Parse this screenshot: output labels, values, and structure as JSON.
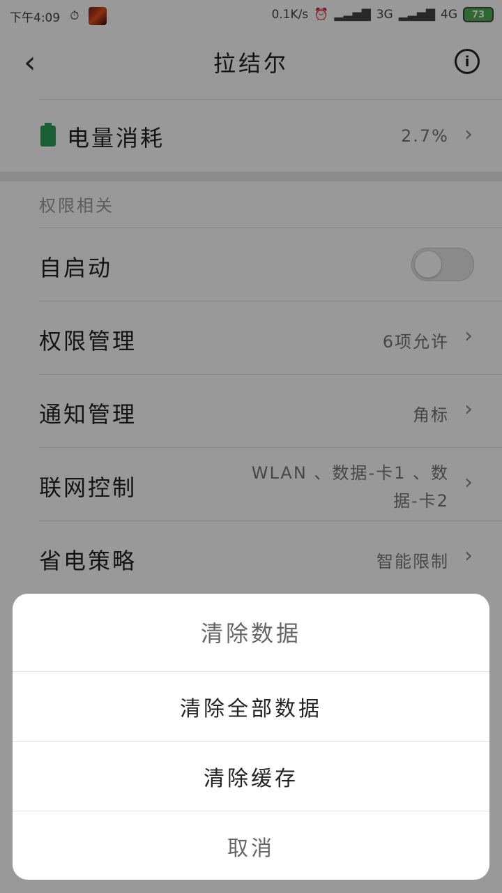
{
  "status_bar": {
    "time": "下午4:09",
    "net_speed": "0.1K/s",
    "sim1": "3G",
    "sim2": "4G",
    "battery": "73"
  },
  "header": {
    "title": "拉结尔"
  },
  "power": {
    "label": "电量消耗",
    "value": "2.7%"
  },
  "permissions": {
    "section_title": "权限相关",
    "items": [
      {
        "label": "自启动",
        "value": "",
        "toggle_on": false
      },
      {
        "label": "权限管理",
        "value": "6项允许"
      },
      {
        "label": "通知管理",
        "value": "角标"
      },
      {
        "label": "联网控制",
        "value_line1": "WLAN 、数据-卡1 、数",
        "value_line2": "据-卡2"
      },
      {
        "label": "省电策略",
        "value": "智能限制"
      }
    ]
  },
  "dialog": {
    "title": "清除数据",
    "options": [
      "清除全部数据",
      "清除缓存"
    ],
    "cancel": "取消"
  }
}
